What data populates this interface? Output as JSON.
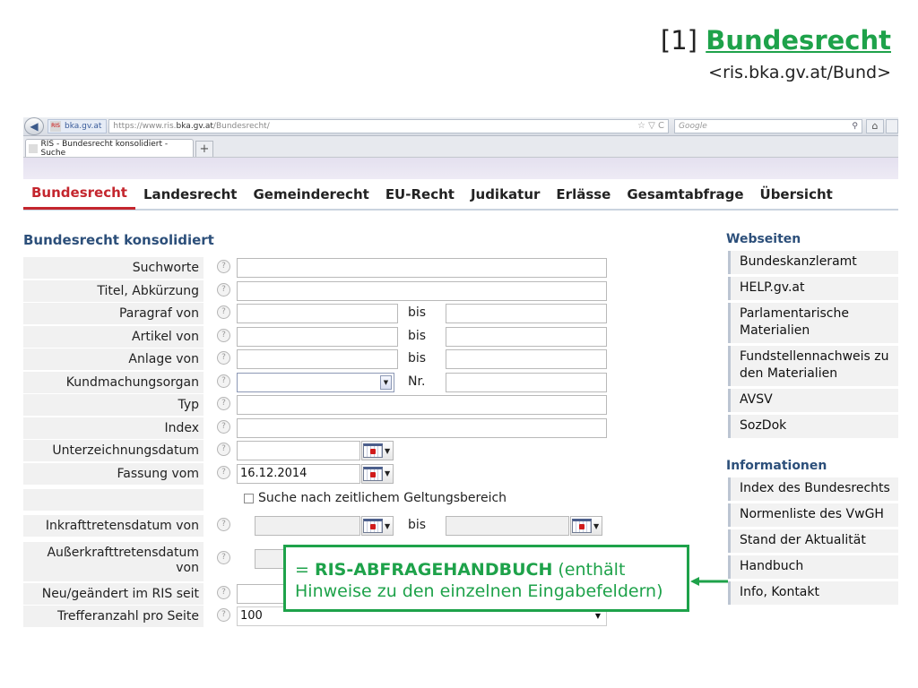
{
  "slide": {
    "number": "[1]",
    "title_link": "Bundesrecht",
    "url": "<ris.bka.gv.at/Bund>"
  },
  "browser": {
    "site_identity": "bka.gv.at",
    "url_prefix": "https://www.ris.",
    "url_domain": "bka.gv.at",
    "url_suffix": "/Bundesrecht/",
    "url_tools": "☆ ▽ C",
    "search_placeholder": "Google",
    "tab_title": "RIS - Bundesrecht konsolidiert - Suche",
    "newtab": "+"
  },
  "nav": {
    "items": [
      "Bundesrecht",
      "Landesrecht",
      "Gemeinderecht",
      "EU-Recht",
      "Judikatur",
      "Erlässe",
      "Gesamtabfrage",
      "Übersicht"
    ]
  },
  "page": {
    "heading": "Bundesrecht konsolidiert"
  },
  "form": {
    "help_glyph": "?",
    "bis": "bis",
    "nr": "Nr.",
    "checkbox_label": "Suche nach zeitlichem Geltungsbereich",
    "labels": {
      "suchworte": "Suchworte",
      "titel": "Titel, Abkürzung",
      "paragraf": "Paragraf von",
      "artikel": "Artikel von",
      "anlage": "Anlage von",
      "kundmachungsorgan": "Kundmachungsorgan",
      "typ": "Typ",
      "index": "Index",
      "unterzeichnungsdatum": "Unterzeichnungsdatum",
      "fassung": "Fassung vom",
      "inkraft": "Inkrafttretensdatum von",
      "ausserkraft_1": "Außerkrafttretensdatum",
      "ausserkraft_2": "von",
      "neu": "Neu/geändert im RIS seit",
      "treffer": "Trefferanzahl pro Seite"
    },
    "values": {
      "fassung": "16.12.2014",
      "treffer": "100"
    }
  },
  "sidebar": {
    "webseiten_heading": "Webseiten",
    "webseiten": [
      "Bundeskanzleramt",
      "HELP.gv.at",
      "Parlamentarische Materialien",
      "Fundstellennachweis zu den Materialien",
      "AVSV",
      "SozDok"
    ],
    "info_heading": "Informationen",
    "informationen": [
      "Index des Bundesrechts",
      "Normenliste des VwGH",
      "Stand der Aktualität",
      "Handbuch",
      "Info, Kontakt"
    ]
  },
  "annotation": {
    "prefix": "= ",
    "bold": "RIS-ABFRAGEHANDBUCH",
    "rest": " (enthält Hinweise zu den einzelnen Eingabefeldern)"
  },
  "colors": {
    "accent_green": "#1ea24a",
    "nav_active": "#c4262e",
    "heading_blue": "#2c4f7a"
  }
}
